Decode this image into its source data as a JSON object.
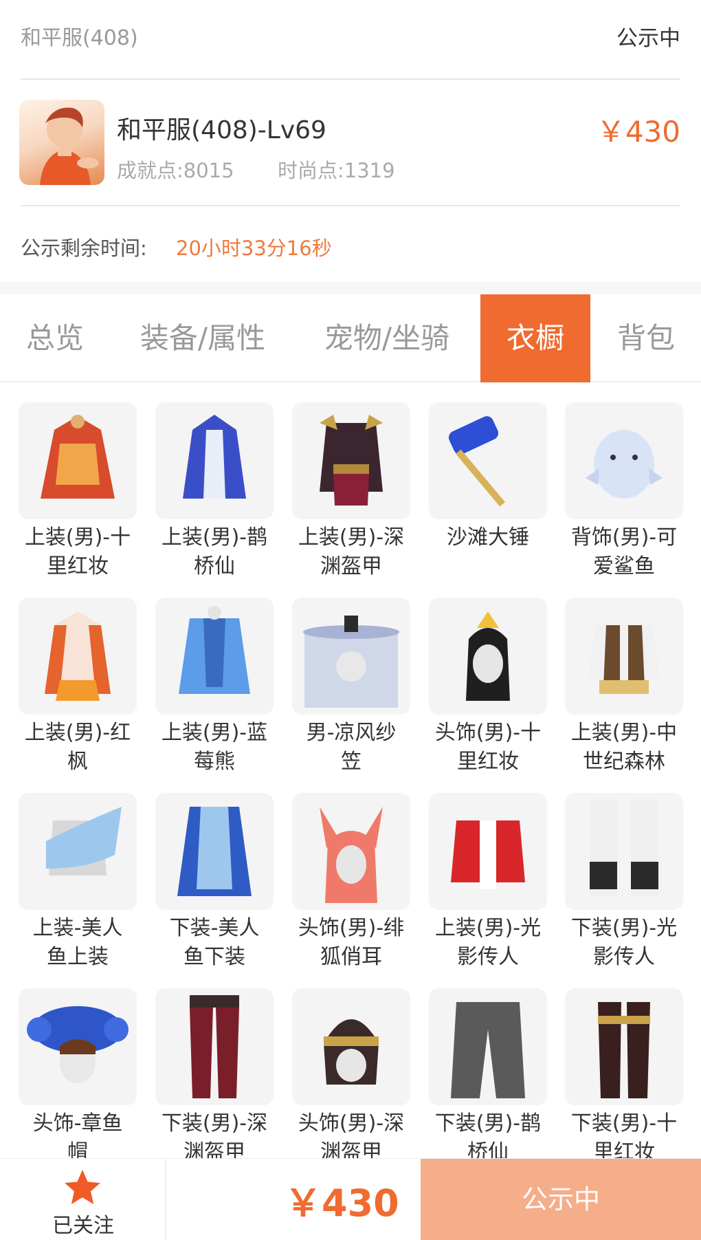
{
  "header": {
    "server": "和平服(408)",
    "status": "公示中"
  },
  "role": {
    "title": "和平服(408)-Lv69",
    "price": "￥430",
    "achievement": "成就点:8015",
    "fashion": "时尚点:1319",
    "remain_label": "公示剩余时间:",
    "remain_value": "20小时33分16秒"
  },
  "tabs": [
    {
      "label": "总览"
    },
    {
      "label": "装备/属性"
    },
    {
      "label": "宠物/坐骑"
    },
    {
      "label": "衣橱",
      "active": true
    },
    {
      "label": "背包"
    }
  ],
  "wardrobe": [
    {
      "line1": "上装(男)-十",
      "line2": "里红妆",
      "icon": "red-robe"
    },
    {
      "line1": "上装(男)-鹊",
      "line2": "桥仙",
      "icon": "blue-robe"
    },
    {
      "line1": "上装(男)-深",
      "line2": "渊盔甲",
      "icon": "dark-armor"
    },
    {
      "line1": "沙滩大锤",
      "line2": "",
      "icon": "hammer"
    },
    {
      "line1": "背饰(男)-可",
      "line2": "爱鲨鱼",
      "icon": "shark-backpack"
    },
    {
      "line1": "上装(男)-红",
      "line2": "枫",
      "icon": "maple-robe"
    },
    {
      "line1": "上装(男)-蓝",
      "line2": "莓熊",
      "icon": "plaid-coat"
    },
    {
      "line1": "男-凉风纱",
      "line2": "笠",
      "icon": "veil-hat"
    },
    {
      "line1": "头饰(男)-十",
      "line2": "里红妆",
      "icon": "hair-ornament"
    },
    {
      "line1": "上装(男)-中",
      "line2": "世纪森林",
      "icon": "vest"
    },
    {
      "line1": "上装-美人",
      "line2": "鱼上装",
      "icon": "mermaid-top"
    },
    {
      "line1": "下装-美人",
      "line2": "鱼下装",
      "icon": "mermaid-bottom"
    },
    {
      "line1": "头饰(男)-绯",
      "line2": "狐俏耳",
      "icon": "fox-ears"
    },
    {
      "line1": "上装(男)-光",
      "line2": "影传人",
      "icon": "red-jacket"
    },
    {
      "line1": "下装(男)-光",
      "line2": "影传人",
      "icon": "white-boots"
    },
    {
      "line1": "头饰-章鱼",
      "line2": "帽",
      "icon": "octopus-hat"
    },
    {
      "line1": "下装(男)-深",
      "line2": "渊盔甲",
      "icon": "dark-pants"
    },
    {
      "line1": "头饰(男)-深",
      "line2": "渊盔甲",
      "icon": "dark-helmet"
    },
    {
      "line1": "下装(男)-鹊",
      "line2": "桥仙",
      "icon": "grey-pants"
    },
    {
      "line1": "下装(男)-十",
      "line2": "里红妆",
      "icon": "red-boots"
    }
  ],
  "footer": {
    "follow_label": "已关注",
    "price": "￥430",
    "status_button": "公示中"
  },
  "colors": {
    "accent": "#ef6b2f",
    "button_disabled": "#f5ad8a"
  }
}
